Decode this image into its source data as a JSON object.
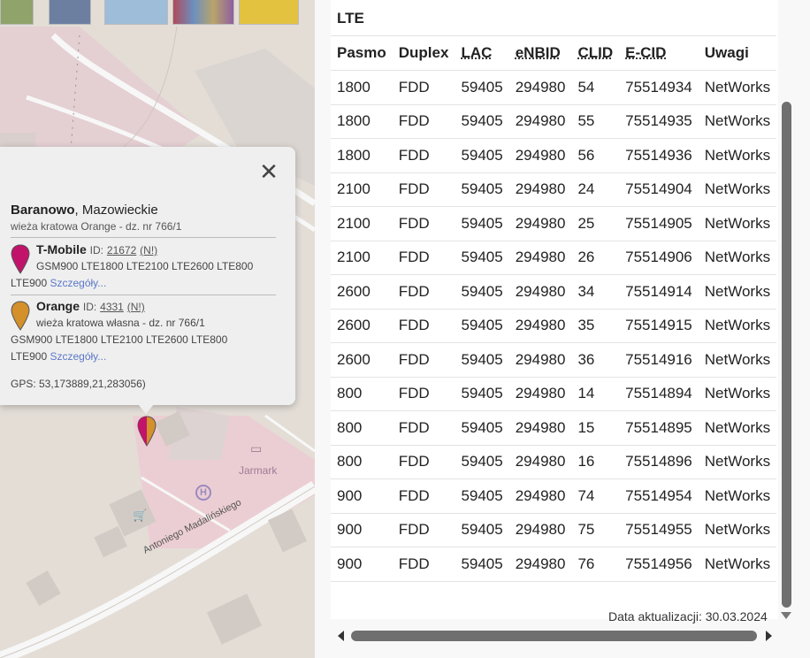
{
  "map": {
    "poi_label": "Jarmark",
    "street_label": "Antoniego Madalińskiego"
  },
  "popup": {
    "close_symbol": "✕",
    "place_name": "Baranowo",
    "place_region": ", Mazowieckie",
    "site_desc": "wieża kratowa Orange - dz. nr 766/1",
    "operators": [
      {
        "name": "T-Mobile",
        "id_label": "ID:",
        "id": "21672",
        "n_label": "(N!)",
        "desc": "",
        "tech_line1": "GSM900 LTE1800 LTE2100 LTE2600 LTE800",
        "tech_line2": "LTE900",
        "more": "Szczegóły...",
        "pin_color": "#c2136b"
      },
      {
        "name": "Orange",
        "id_label": "ID:",
        "id": "4331",
        "n_label": "(N!)",
        "desc": "wieża kratowa własna - dz. nr 766/1",
        "tech_line1": "GSM900 LTE1800 LTE2100 LTE2600 LTE800",
        "tech_line2": "LTE900",
        "more": "Szczegóły...",
        "pin_color": "#d4902a"
      }
    ],
    "gps": "GPS: 53,173889,21,283056)"
  },
  "panel": {
    "section": "LTE",
    "columns": [
      "Pasmo",
      "Duplex",
      "LAC",
      "eNBID",
      "CLID",
      "E-CID",
      "Uwagi"
    ],
    "rows": [
      [
        "1800",
        "FDD",
        "59405",
        "294980",
        "54",
        "75514934",
        "NetWorks"
      ],
      [
        "1800",
        "FDD",
        "59405",
        "294980",
        "55",
        "75514935",
        "NetWorks"
      ],
      [
        "1800",
        "FDD",
        "59405",
        "294980",
        "56",
        "75514936",
        "NetWorks"
      ],
      [
        "2100",
        "FDD",
        "59405",
        "294980",
        "24",
        "75514904",
        "NetWorks"
      ],
      [
        "2100",
        "FDD",
        "59405",
        "294980",
        "25",
        "75514905",
        "NetWorks"
      ],
      [
        "2100",
        "FDD",
        "59405",
        "294980",
        "26",
        "75514906",
        "NetWorks"
      ],
      [
        "2600",
        "FDD",
        "59405",
        "294980",
        "34",
        "75514914",
        "NetWorks"
      ],
      [
        "2600",
        "FDD",
        "59405",
        "294980",
        "35",
        "75514915",
        "NetWorks"
      ],
      [
        "2600",
        "FDD",
        "59405",
        "294980",
        "36",
        "75514916",
        "NetWorks"
      ],
      [
        "800",
        "FDD",
        "59405",
        "294980",
        "14",
        "75514894",
        "NetWorks"
      ],
      [
        "800",
        "FDD",
        "59405",
        "294980",
        "15",
        "75514895",
        "NetWorks"
      ],
      [
        "800",
        "FDD",
        "59405",
        "294980",
        "16",
        "75514896",
        "NetWorks"
      ],
      [
        "900",
        "FDD",
        "59405",
        "294980",
        "74",
        "75514954",
        "NetWorks"
      ],
      [
        "900",
        "FDD",
        "59405",
        "294980",
        "75",
        "75514955",
        "NetWorks"
      ],
      [
        "900",
        "FDD",
        "59405",
        "294980",
        "76",
        "75514956",
        "NetWorks"
      ]
    ],
    "update": "Data aktualizacji: 30.03.2024"
  }
}
